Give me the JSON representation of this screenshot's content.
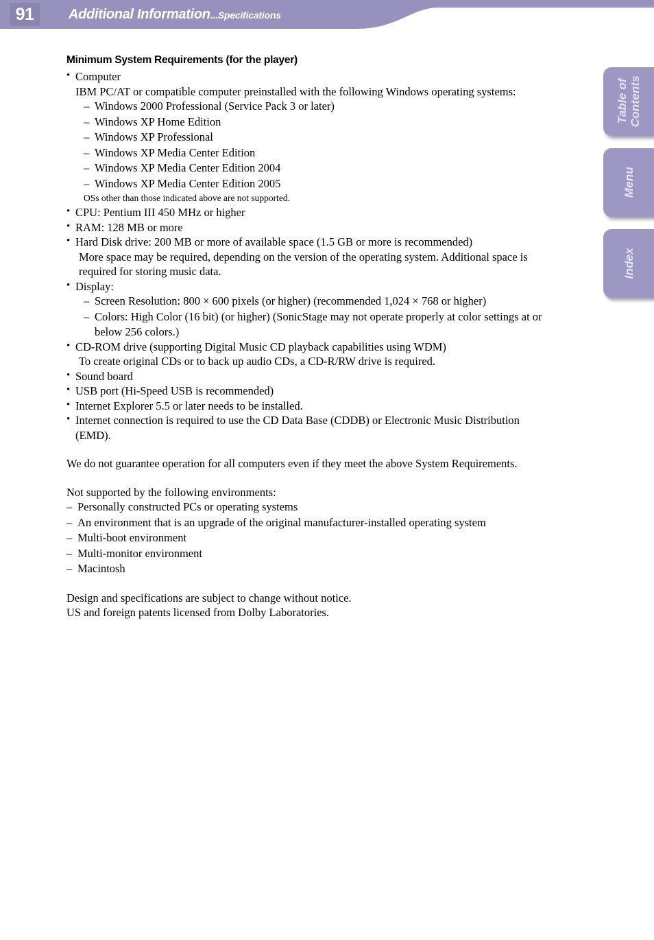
{
  "header": {
    "page_number": "91",
    "title_main": "Additional Information",
    "title_ellipsis": "...",
    "title_sub": "Specifications",
    "banner_color": "#9792bd",
    "page_number_bg": "#8a85ae",
    "text_color": "#ffffff"
  },
  "side_tabs": [
    {
      "name": "table-of-contents",
      "label": "Table of\nContents"
    },
    {
      "name": "menu",
      "label": "Menu"
    },
    {
      "name": "index",
      "label": "Index"
    }
  ],
  "tab_color": "#9d97c4",
  "tab_text_color": "#e6e2f2",
  "content": {
    "section_heading": "Minimum System Requirements (for the player)",
    "computer_bullet": "Computer",
    "computer_intro": "IBM PC/AT or compatible computer preinstalled with the following Windows operating systems:",
    "os_list": [
      "Windows 2000 Professional (Service Pack 3 or later)",
      "Windows XP Home Edition",
      "Windows XP Professional",
      "Windows XP Media Center Edition",
      "Windows XP Media Center Edition 2004",
      "Windows XP Media Center Edition 2005"
    ],
    "os_note": "OSs other than those indicated above are not supported.",
    "cpu_bullet": "CPU: Pentium III 450 MHz or higher",
    "ram_bullet": "RAM: 128 MB or more",
    "hdd_bullet": "Hard Disk drive: 200 MB or more of available space (1.5 GB or more is recommended)",
    "hdd_note_line1": "More space may be required, depending on the version of the operating system. Additional space is",
    "hdd_note_line2": "required for storing music data.",
    "display_bullet": "Display:",
    "display_resolution": "Screen Resolution: 800 × 600 pixels (or higher) (recommended 1,024 × 768 or higher)",
    "display_colors_line1": "Colors: High Color (16 bit) (or higher) (SonicStage may not operate properly at color settings at or",
    "display_colors_line2": "below 256 colors.)",
    "cdrom_bullet": "CD-ROM drive (supporting Digital Music CD playback capabilities using WDM)",
    "cdrom_note": "To create original CDs or to back up audio CDs, a CD-R/RW drive is required.",
    "sound_bullet": "Sound board",
    "usb_bullet": "USB port (Hi-Speed USB is recommended)",
    "ie_bullet": "Internet Explorer 5.5 or later needs to be installed.",
    "internet_bullet_line1": "Internet connection is required to use the CD Data Base (CDDB) or Electronic Music Distribution",
    "internet_bullet_line2": "(EMD).",
    "guarantee_para": "We do not guarantee operation for all computers even if they meet the above System Requirements.",
    "unsupported_intro": "Not supported by the following environments:",
    "unsupported_list": [
      "Personally constructed PCs or operating systems",
      "An environment that is an upgrade of the original manufacturer-installed operating system",
      "Multi-boot environment",
      "Multi-monitor environment",
      "Macintosh"
    ],
    "closing_line1": "Design and specifications are subject to change without notice.",
    "closing_line2": "US and foreign patents licensed from Dolby Laboratories."
  }
}
